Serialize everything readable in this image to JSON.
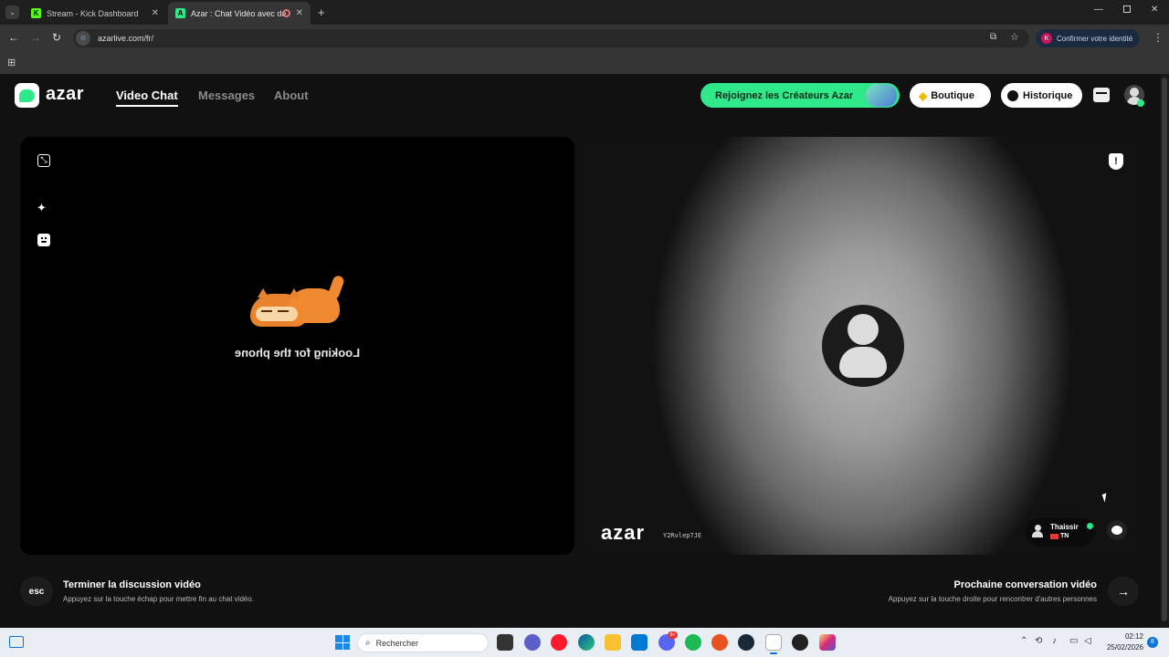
{
  "browser": {
    "tabs": [
      {
        "title": "Stream - Kick Dashboard",
        "favicon": "K"
      },
      {
        "title": "Azar : Chat Vidéo avec de n",
        "favicon": "A"
      }
    ],
    "url": "azarlive.com/fr/",
    "profile_button": "Confirmer votre identité",
    "profile_initial": "K"
  },
  "header": {
    "logo_text": "azar",
    "nav": [
      "Video Chat",
      "Messages",
      "About"
    ],
    "creators_button": "Rejoignez les Créateurs Azar",
    "shop_button": "Boutique",
    "history_button": "Historique"
  },
  "left_panel": {
    "status_text": "Looking for the phone"
  },
  "right_panel": {
    "watermark": "azar",
    "watermark_id": "Y2Rvlep7JE",
    "partner_name": "Thaissir",
    "partner_country": "TN"
  },
  "footer": {
    "esc_key": "esc",
    "end_title": "Terminer la discussion vidéo",
    "end_sub": "Appuyez sur la touche échap pour mettre fin au chat vidéo.",
    "next_title": "Prochaine conversation vidéo",
    "next_sub": "Appuyez sur la touche droite pour rencontrer d'autres personnes"
  },
  "taskbar": {
    "search_placeholder": "Rechercher",
    "time": "02:12",
    "date": "25/02/2026",
    "notif_count": "8",
    "discord_badge": "9+"
  },
  "colors": {
    "accent_green": "#2ee88a",
    "page_bg": "#111111"
  }
}
